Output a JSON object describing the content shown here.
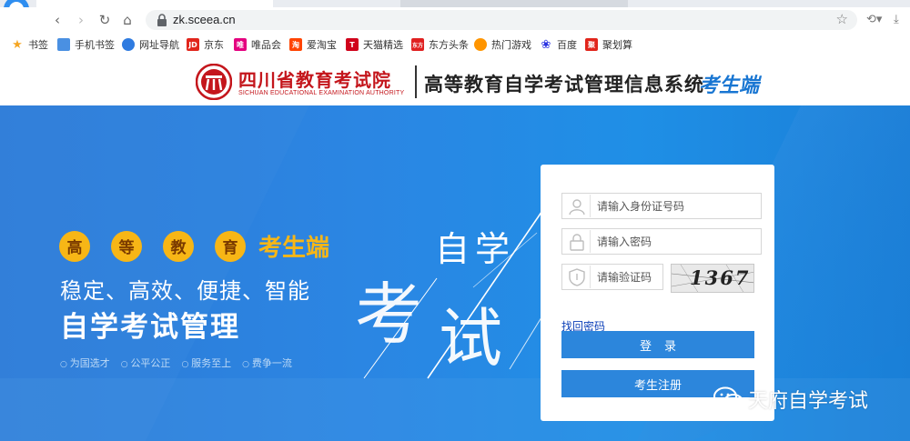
{
  "browser": {
    "url": "zk.sceea.cn",
    "bookmarks": [
      {
        "label": "书签",
        "color": "#f5a623"
      },
      {
        "label": "手机书签",
        "color": "#4a90e2"
      },
      {
        "label": "网址导航",
        "color": "#2f7be0"
      },
      {
        "label": "京东",
        "color": "#e1251b",
        "icon_text": "JD"
      },
      {
        "label": "唯品会",
        "color": "#e4007f",
        "icon_text": "唯"
      },
      {
        "label": "爱淘宝",
        "color": "#ff4400",
        "icon_text": "淘"
      },
      {
        "label": "天猫精选",
        "color": "#d0021b",
        "icon_text": "T"
      },
      {
        "label": "东方头条",
        "color": "#e02020",
        "icon_text": "东方"
      },
      {
        "label": "热门游戏",
        "color": "#ff9500"
      },
      {
        "label": "百度",
        "color": "#2932e1"
      },
      {
        "label": "聚划算",
        "color": "#e1251b",
        "icon_text": "聚"
      }
    ]
  },
  "header": {
    "org_name_cn": "四川省教育考试院",
    "org_name_en": "SICHUAN EDUCATIONAL EXAMINATION AUTHORITY",
    "system_title": "高等教育自学考试管理信息系统",
    "system_subtitle": "考生端"
  },
  "banner": {
    "badges": [
      "高",
      "等",
      "教",
      "育"
    ],
    "badge_tag": "考生端",
    "slogan_line1": "稳定、高效、便捷、智能",
    "slogan_line2": "自学考试管理",
    "mottos": [
      "为国选才",
      "公平公正",
      "服务至上",
      "费争一流"
    ],
    "art_text1": "自学",
    "art_text2": "考",
    "art_text3": "试"
  },
  "login": {
    "id_placeholder": "请输入身份证号码",
    "password_placeholder": "请输入密码",
    "captcha_placeholder": "请输验证码",
    "captcha_text": "1367",
    "forgot_label": "找回密码",
    "login_label": "登录",
    "register_label": "考生注册"
  },
  "watermark": {
    "text": "天府自学考试"
  }
}
